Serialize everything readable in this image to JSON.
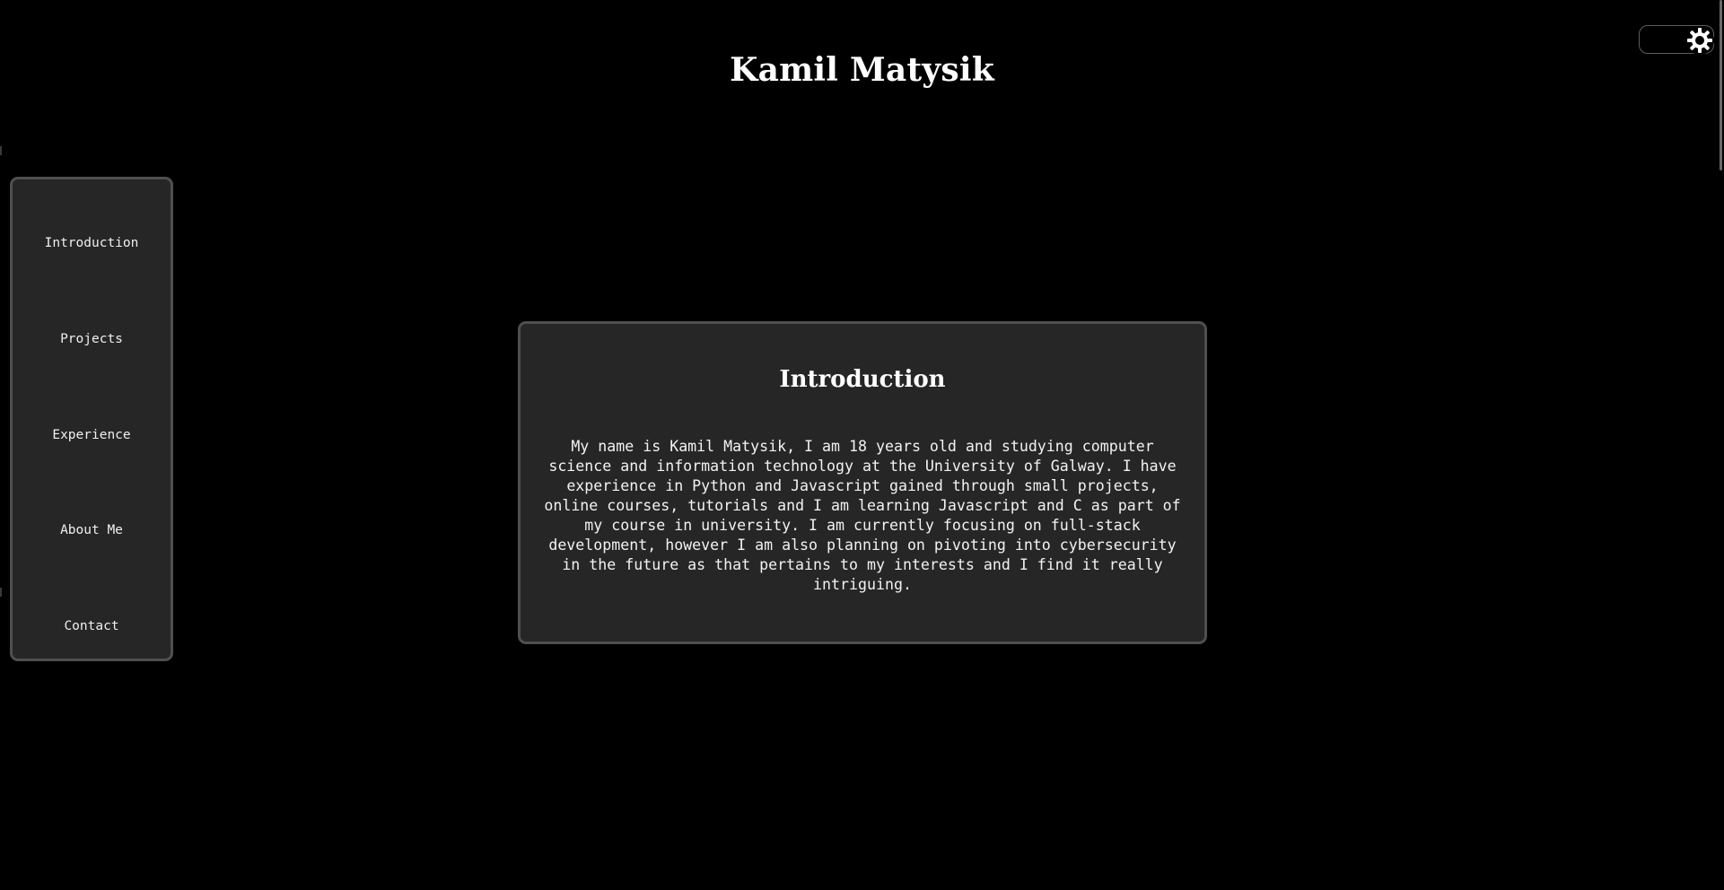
{
  "header": {
    "title": "Kamil Matysik"
  },
  "theme_toggle": {
    "icon": "gear-icon",
    "state": "dark"
  },
  "sidebar": {
    "items": [
      {
        "label": "Introduction"
      },
      {
        "label": "Projects"
      },
      {
        "label": "Experience"
      },
      {
        "label": "About Me"
      },
      {
        "label": "Contact"
      }
    ]
  },
  "main": {
    "section_title": "Introduction",
    "section_text": "My name is Kamil Matysik, I am 18 years old and studying computer science and information technology at the University of Galway. I have experience in Python and Javascript gained through small projects, online courses, tutorials and I am learning Javascript and C as part of my course in university. I am currently focusing on full-stack development, however I am also planning on pivoting into cybersecurity in the future as that pertains to my interests and I find it really intriguing."
  },
  "colors": {
    "background": "#000000",
    "panel": "#262626",
    "panel_border": "#4f4f4f",
    "text": "#ffffff"
  }
}
